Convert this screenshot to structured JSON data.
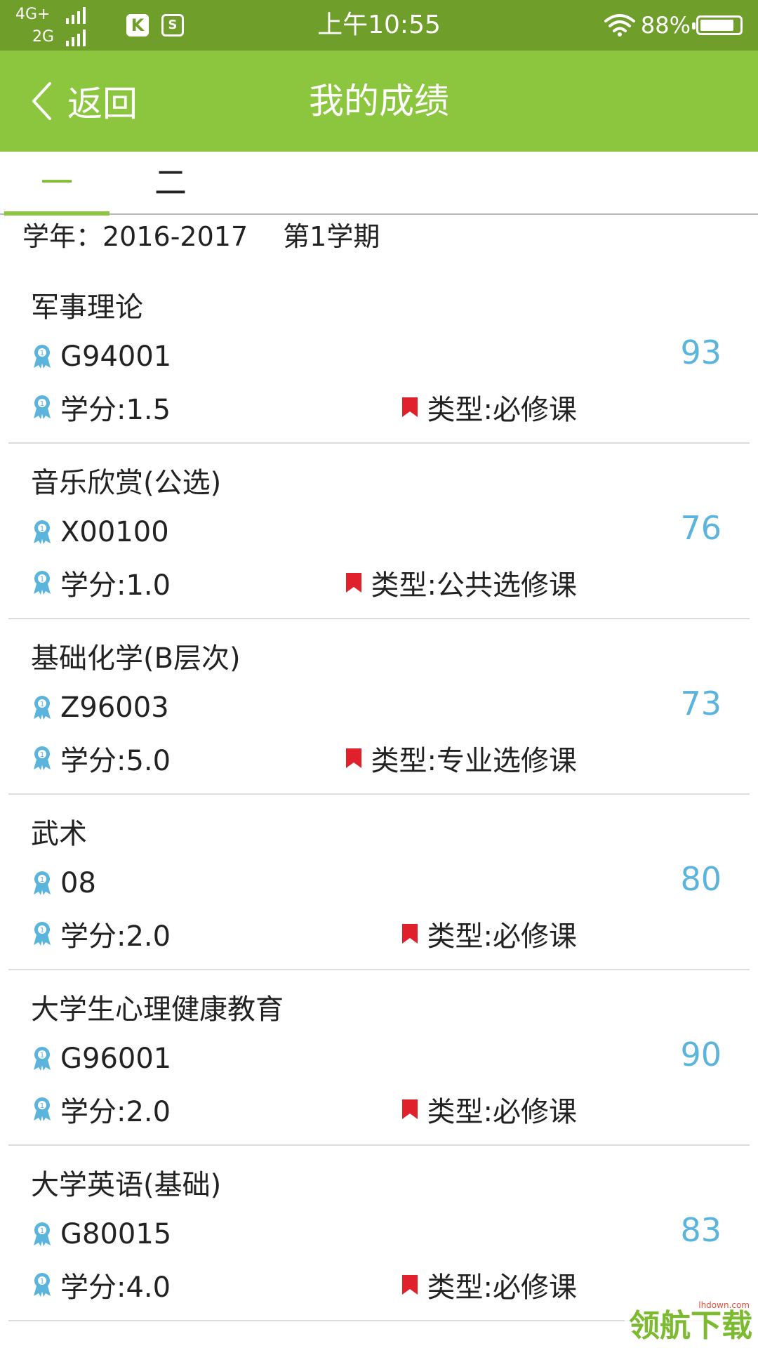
{
  "status_bar": {
    "network_top": "4G+",
    "network_bottom": "2G",
    "app_icon_1": "K",
    "app_icon_2": "S",
    "time": "上午10:55",
    "battery": "88%",
    "battery_level": 0.88,
    "icons": [
      "signal-icon",
      "k-app-icon",
      "s-app-icon",
      "wifi-icon",
      "battery-icon"
    ]
  },
  "header": {
    "back_label": "返回",
    "title": "我的成绩",
    "color": "#8cc63f"
  },
  "tabs": [
    {
      "label": "一",
      "active": true
    },
    {
      "label": "二",
      "active": false
    }
  ],
  "term": {
    "year": "学年：2016-2017",
    "semester": "第1学期"
  },
  "courses": [
    {
      "name": "军事理论",
      "code": "G94001",
      "credit": "学分:1.5",
      "type": "类型:必修课",
      "score": "93"
    },
    {
      "name": "音乐欣赏(公选)",
      "code": "X00100",
      "credit": "学分:1.0",
      "type": "类型:公共选修课",
      "score": "76"
    },
    {
      "name": "基础化学(B层次)",
      "code": "Z96003",
      "credit": "学分:5.0",
      "type": "类型:专业选修课",
      "score": "73"
    },
    {
      "name": "武术",
      "code": "08",
      "credit": "学分:2.0",
      "type": "类型:必修课",
      "score": "80"
    },
    {
      "name": "大学生心理健康教育",
      "code": "G96001",
      "credit": "学分:2.0",
      "type": "类型:必修课",
      "score": "90"
    },
    {
      "name": "大学英语(基础)",
      "code": "G80015",
      "credit": "学分:4.0",
      "type": "类型:必修课",
      "score": "83"
    }
  ],
  "colors": {
    "score": "#5ab4dc",
    "ribbon_icon": "#5ab4dc",
    "flag_icon": "#e0202a"
  },
  "watermark": {
    "text": "领航下载",
    "sub": "lhdown.com"
  }
}
